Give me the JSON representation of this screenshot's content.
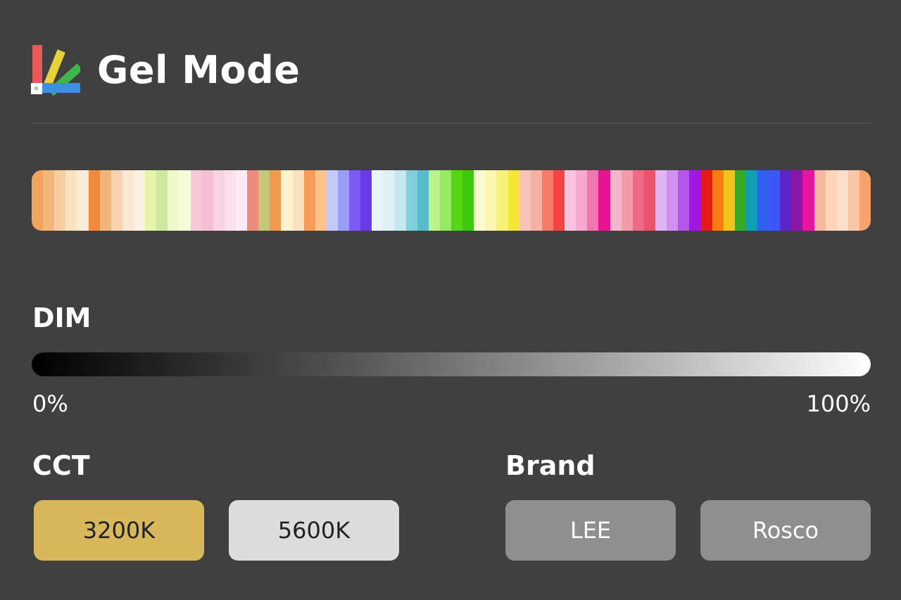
{
  "header": {
    "title": "Gel Mode",
    "icon": "gel-swatch-fan-icon"
  },
  "gel_strip": {
    "colors": [
      "#f2a35e",
      "#efb77a",
      "#f5cfa0",
      "#fae1c2",
      "#fbecd9",
      "#f08a3a",
      "#f0b57a",
      "#f9d2b0",
      "#fbe5d3",
      "#fdf1e4",
      "#e6f4a8",
      "#cfe8a0",
      "#eef9c8",
      "#f6fbdc",
      "#f6c8d8",
      "#f3bed2",
      "#f7d2e0",
      "#fae0eb",
      "#fcebf2",
      "#ec8b7c",
      "#c6c77a",
      "#f09b50",
      "#fdf5cf",
      "#fbe2be",
      "#f79a55",
      "#fbc28a",
      "#c5c8f5",
      "#9c9cf2",
      "#7a5cf0",
      "#6a3ce8",
      "#eaf4fa",
      "#dff0f5",
      "#c4e6ee",
      "#7fd0dc",
      "#56bccb",
      "#b9f58c",
      "#96ea62",
      "#58d616",
      "#3ec90a",
      "#fbfbd2",
      "#fbf6b0",
      "#f7f17c",
      "#f5e73a",
      "#f6c3b7",
      "#f5b0a2",
      "#f57c6a",
      "#f44545",
      "#f8c6e0",
      "#f5a9cc",
      "#ee77b2",
      "#e9128f",
      "#f5b6c8",
      "#f49aaa",
      "#ed6a87",
      "#e9546e",
      "#e0b4f6",
      "#cf92f0",
      "#b357ea",
      "#a116e0",
      "#e61a1a",
      "#f57b12",
      "#f2c21b",
      "#37a82a",
      "#0e9fb2",
      "#2f60ef",
      "#3b57f5",
      "#5b23c8",
      "#8817a8",
      "#e616a0",
      "#f8b8a0",
      "#fcd5b8",
      "#fde0cc",
      "#fbc4a2",
      "#f6a36e"
    ]
  },
  "dim": {
    "label": "DIM",
    "min_label": "0%",
    "max_label": "100%",
    "value_percent": 0
  },
  "cct": {
    "label": "CCT",
    "options": [
      {
        "label": "3200K",
        "selected": true,
        "color": "#d9b85d"
      },
      {
        "label": "5600K",
        "selected": false,
        "color": "#dcdcdc"
      }
    ]
  },
  "brand": {
    "label": "Brand",
    "options": [
      {
        "label": "LEE",
        "selected": false
      },
      {
        "label": "Rosco",
        "selected": false
      }
    ]
  },
  "theme": {
    "background": "#404040",
    "button_gray": "#8f8f8f",
    "accent_gold": "#d9b85d"
  }
}
